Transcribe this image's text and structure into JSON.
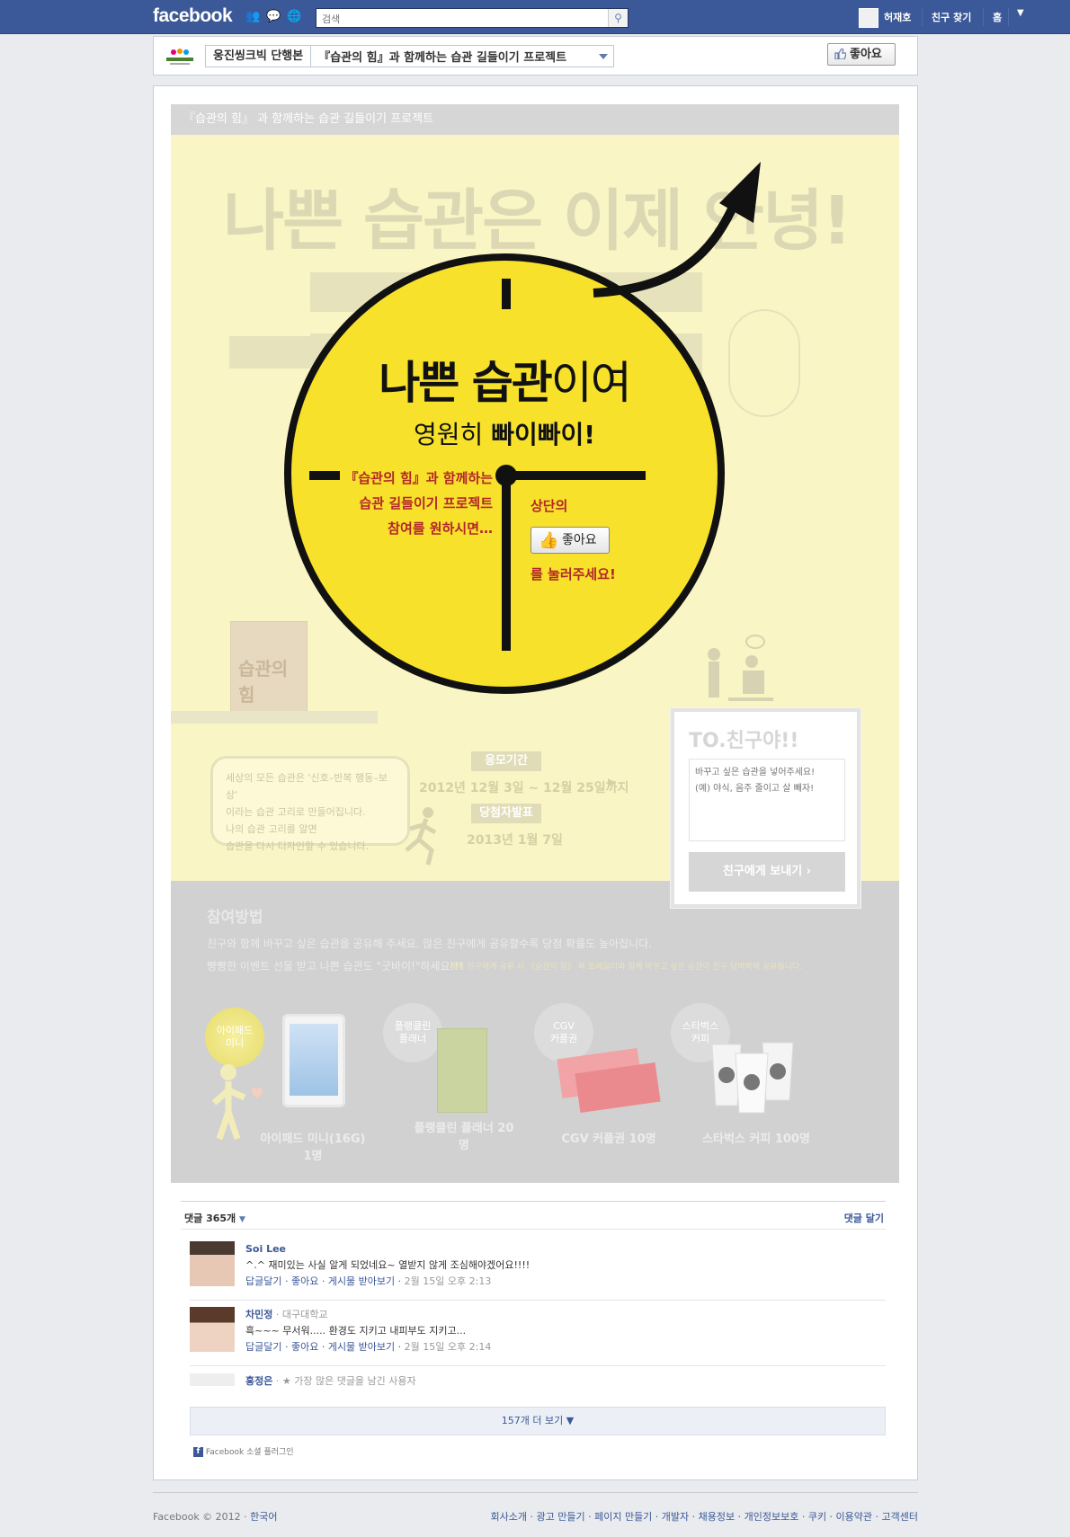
{
  "topbar": {
    "logo": "facebook",
    "search_placeholder": "검색",
    "user_name": "허재호",
    "find_friends": "친구 찾기",
    "home": "홈"
  },
  "page_header": {
    "page_name": "웅진씽크빅 단행본",
    "tab_name": "『습관의 힘』과 함께하는 습관 길들이기 프로젝트",
    "like_label": "좋아요"
  },
  "banner": {
    "top_title": "『습관의 힘』 과 함께하는 습관 길들이기 프로젝트",
    "headline_ghost": "나쁜 습관은 이제 안녕!",
    "circle": {
      "line1_bold": "나쁜 습관",
      "line1_light": "이여",
      "line2_light": "영원히 ",
      "line2_bold": "빠이빠이!",
      "left_lines": [
        "『습관의 힘』과 함께하는",
        "습관 길들이기 프로젝트",
        "참여를 원하시면…"
      ],
      "right_top": "상단의",
      "like_label": "좋아요",
      "right_bottom": "를 눌러주세요!"
    },
    "bubble_lines": [
      "세상의 모든 습관은 '신호–반복 행동–보상'",
      "이라는 습관 고리로 만들어집니다.",
      "나의 습관 고리를 알면",
      "습관을 다시 디자인할 수 있습니다."
    ],
    "period_label": "응모기간",
    "period_value": "2012년 12월 3일 ~ 12월 25일까지",
    "winner_label": "당첨자발표",
    "winner_value": "2013년 1월 7일",
    "book_title": "습관의 힘",
    "friend_box": {
      "title": "TO.친구야!!",
      "placeholder": "바꾸고 싶은 습관을 넣어주세요!\n(예) 야식, 음주 줄이고 살 빼자!",
      "send_label": "친구에게 보내기"
    },
    "howto_title": "참여방법",
    "howto_line1": "친구와 함께 바꾸고 싶은 습관을 공유해 주세요. 많은 친구에게 공유할수록 당첨 확률도 높아집니다.",
    "howto_line2": "빵빵한 이벤트 선물 받고 나쁜 습관도 \"굿바이!\"하세요!!!",
    "howto_note": "페북 친구에게 공유 시 《습관의 힘》 북 트레일러와 함께 바꾸고 싶은 습관이 친구 담벼락에 공유됩니다.",
    "prizes": [
      {
        "badge": "아이패드\n미니",
        "label": "아이패드 미니(16G) 1명"
      },
      {
        "badge": "플랭클린\n플래너",
        "label": "플랭클린 플래너 20명"
      },
      {
        "badge": "CGV\n커플권",
        "label": "CGV 커플권 10명"
      },
      {
        "badge": "스타벅스\n커피",
        "label": "스타벅스 커피 100명"
      }
    ]
  },
  "comments": {
    "count": "댓글 365개",
    "write": "댓글 달기",
    "items": [
      {
        "name": "Soi Lee",
        "sub": "",
        "text": "^.^ 재미있는 사실 알게 되었네요~ 열받지 않게 조심해야겠어요!!!!",
        "links": "답글달기 · 좋아요 · 게시물 받아보기 · ",
        "time": "2월 15일 오후 2:13"
      },
      {
        "name": "차민정",
        "sub": " · 대구대학교",
        "text": "흑~~~ 무서워..... 환경도 지키고 내피부도 지키고...",
        "links": "답글달기 · 좋아요 · 게시물 받아보기 · ",
        "time": "2월 15일 오후 2:14"
      },
      {
        "name": "홍정은",
        "sub": " · ★ 가장 많은 댓글을 남긴 사용자",
        "text": "",
        "links": "",
        "time": ""
      }
    ],
    "more": "157개 더 보기",
    "plugin": "Facebook 소셜 플러그인"
  },
  "footer": {
    "copyright": "Facebook © 2012 · ",
    "language": "한국어",
    "links": "회사소개 · 광고 만들기 · 페이지 만들기 · 개발자 · 채용정보 · 개인정보보호 · 쿠키 · 이용약관 · 고객센터"
  },
  "colors": {
    "fb_blue": "#3b5998",
    "circle_yellow": "#f7e12a",
    "accent_red": "#c6242b",
    "banner_yellow": "#faf5c4"
  }
}
